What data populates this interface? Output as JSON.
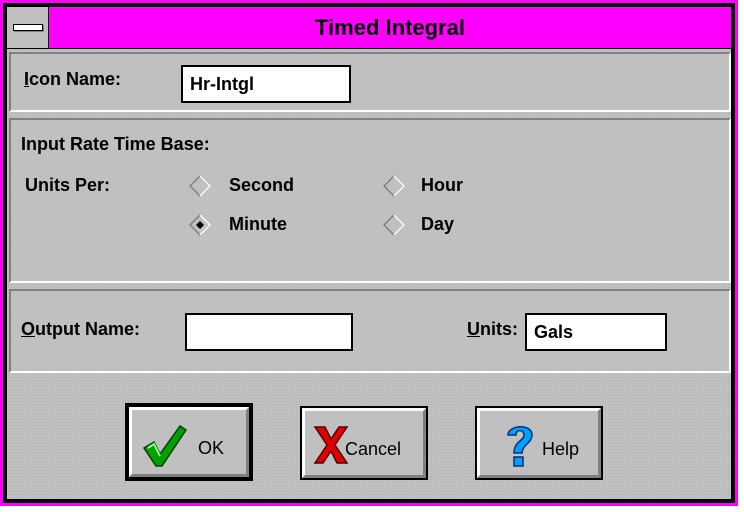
{
  "window": {
    "title": "Timed Integral"
  },
  "icon_section": {
    "label": "Icon Name:",
    "value": "Hr-Intgl"
  },
  "rate_section": {
    "heading": "Input Rate Time Base:",
    "units_per_label": "Units Per:",
    "options": [
      {
        "label": "Second",
        "selected": false
      },
      {
        "label": "Minute",
        "selected": true
      },
      {
        "label": "Hour",
        "selected": false
      },
      {
        "label": "Day",
        "selected": false
      }
    ]
  },
  "output_section": {
    "name_label": "Output Name:",
    "name_value": "",
    "units_label": "Units:",
    "units_value": "Gals"
  },
  "buttons": {
    "ok": "OK",
    "cancel": "Cancel",
    "help": "Help"
  },
  "colors": {
    "title_bar": "#ff00ff",
    "dialog_face": "#c0c0c0",
    "check": "#00a000",
    "x": "#e00000",
    "help": "#00a0ff"
  }
}
